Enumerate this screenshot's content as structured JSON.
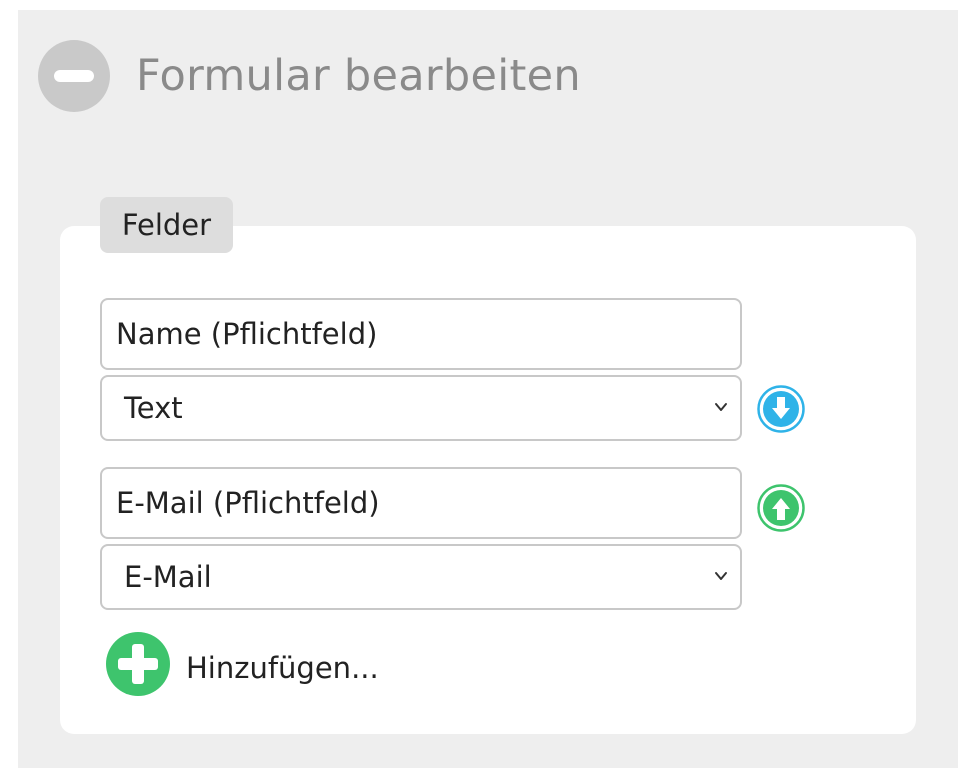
{
  "panel": {
    "title": "Formular bearbeiten",
    "collapse_icon": "minus-circle-icon"
  },
  "section": {
    "tab_label": "Felder"
  },
  "fields": [
    {
      "name_value": "Name (Pflichtfeld)",
      "type_value": "Text",
      "move_icon": "arrow-down-circle-icon",
      "move_color": "#2fb3e8"
    },
    {
      "name_value": "E-Mail (Pflichtfeld)",
      "type_value": "E-Mail",
      "move_icon": "arrow-up-circle-icon",
      "move_color": "#3ec46d"
    }
  ],
  "add": {
    "label": "Hinzufügen...",
    "icon": "plus-circle-icon",
    "color": "#3ec46d"
  },
  "colors": {
    "panel_bg": "#eeeeee",
    "card_bg": "#ffffff",
    "title_text": "#8a8a8a",
    "border": "#c8c8c8"
  }
}
